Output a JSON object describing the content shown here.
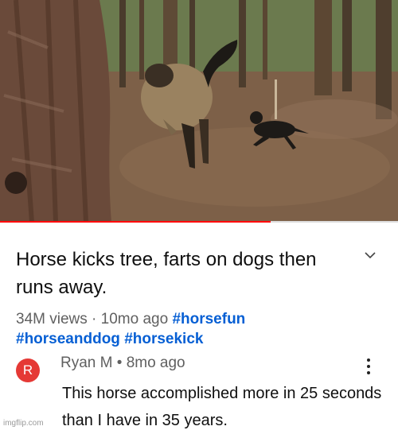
{
  "video": {
    "progress_fraction": 0.68
  },
  "title": "Horse kicks tree, farts on dogs then runs away.",
  "meta": {
    "views": "34M views",
    "separator": "·",
    "age": "10mo ago",
    "hashtags": [
      "#horsefun",
      "#horseanddog",
      "#horsekick"
    ]
  },
  "comment": {
    "avatar_letter": "R",
    "avatar_color": "#e53935",
    "author": "Ryan M",
    "dot": "•",
    "age": "8mo ago",
    "text": "This horse accomplished more in 25 seconds than I have in 35 years."
  },
  "icons": {
    "expand": "chevron-down-icon",
    "more": "more-vertical-icon"
  },
  "watermark": "imgflip.com"
}
